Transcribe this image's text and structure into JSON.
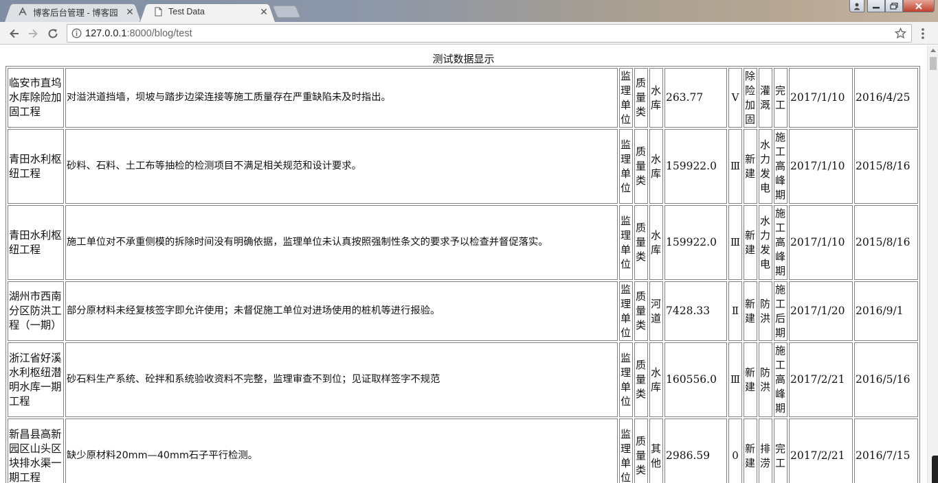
{
  "browser": {
    "tabs": [
      {
        "title": "博客后台管理 - 博客园",
        "active": false,
        "favicon": "blog-logo-icon"
      },
      {
        "title": "Test Data",
        "active": true,
        "favicon": "page-icon"
      }
    ],
    "url_host": "127.0.0.1",
    "url_rest": ":8000/blog/test",
    "colors": {
      "chrome": "#f2f2f2",
      "close_button": "#c0412b"
    }
  },
  "page": {
    "title": "测试数据显示",
    "rows": [
      {
        "project": "临安市直坞水库除险加固工程",
        "issue": "对溢洪道挡墙，坝坡与踏步边梁连接等施工质量存在严重缺陷未及时指出。",
        "unit": "监理单位",
        "category": "质量类",
        "type": "水库",
        "amount": "263.77",
        "grade": "Ⅴ",
        "nature": "除险加固",
        "function": "灌溉",
        "stage": "完工",
        "check_date": "2017/1/10",
        "start_date": "2016/4/25"
      },
      {
        "project": "青田水利枢纽工程",
        "issue": "砂料、石料、土工布等抽检的检测项目不满足相关规范和设计要求。",
        "unit": "监理单位",
        "category": "质量类",
        "type": "水库",
        "amount": "159922.0",
        "grade": "Ⅲ",
        "nature": "新建",
        "function": "水力发电",
        "stage": "施工高峰期",
        "check_date": "2017/1/10",
        "start_date": "2015/8/16"
      },
      {
        "project": "青田水利枢纽工程",
        "issue": "施工单位对不承重侧模的拆除时间没有明确依据，监理单位未认真按照强制性条文的要求予以检查并督促落实。",
        "unit": "监理单位",
        "category": "质量类",
        "type": "水库",
        "amount": "159922.0",
        "grade": "Ⅲ",
        "nature": "新建",
        "function": "水力发电",
        "stage": "施工高峰期",
        "check_date": "2017/1/10",
        "start_date": "2015/8/16"
      },
      {
        "project": "湖州市西南分区防洪工程（一期）",
        "issue": "部分原材料未经复核签字即允许使用；未督促施工单位对进场使用的桩机等进行报验。",
        "unit": "监理单位",
        "category": "质量类",
        "type": "河道",
        "amount": "7428.33",
        "grade": "Ⅱ",
        "nature": "新建",
        "function": "防洪",
        "stage": "施工后期",
        "check_date": "2017/1/20",
        "start_date": "2016/9/1"
      },
      {
        "project": "浙江省好溪水利枢纽潜明水库一期工程",
        "issue": "砂石料生产系统、砼拌和系统验收资料不完整，监理审查不到位；见证取样签字不规范",
        "unit": "监理单位",
        "category": "质量类",
        "type": "水库",
        "amount": "160556.0",
        "grade": "Ⅲ",
        "nature": "新建",
        "function": "防洪",
        "stage": "施工高峰期",
        "check_date": "2017/2/21",
        "start_date": "2016/5/16"
      },
      {
        "project": "新昌县高新园区山头区块排水渠一期工程",
        "issue": "缺少原材料20mm—40mm石子平行检测。",
        "unit": "监理单位",
        "category": "质量类",
        "type": "其他",
        "amount": "2986.59",
        "grade": "0",
        "nature": "新建",
        "function": "排涝",
        "stage": "完工",
        "check_date": "2017/2/21",
        "start_date": "2016/7/15"
      }
    ]
  }
}
